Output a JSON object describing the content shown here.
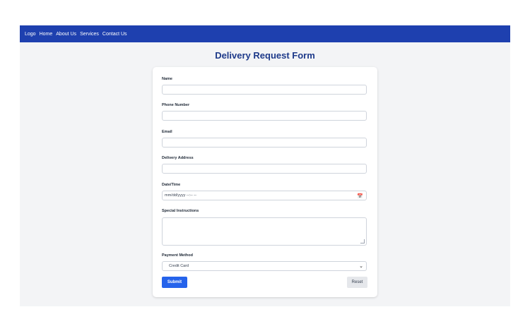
{
  "nav": {
    "items": [
      "Logo",
      "Home",
      "About Us",
      "Services",
      "Contact Us"
    ]
  },
  "page": {
    "title": "Delivery Request Form"
  },
  "form": {
    "name_label": "Name",
    "phone_label": "Phone Number",
    "email_label": "Email",
    "address_label": "Delivery Address",
    "datetime_label": "Date/Time",
    "datetime_placeholder": "mm/dd/yyyy --:-- --",
    "instructions_label": "Special Instructions",
    "payment_label": "Payment Method",
    "payment_selected": "Credit Card",
    "submit_label": "Submit",
    "reset_label": "Reset"
  },
  "icons": {
    "calendar": "calendar-icon",
    "dropdown": "chevron-down-icon"
  },
  "colors": {
    "navbar": "#1e40af",
    "title": "#1e3a8a",
    "submit": "#2563eb",
    "reset": "#e5e7eb",
    "background": "#f3f4f6"
  }
}
